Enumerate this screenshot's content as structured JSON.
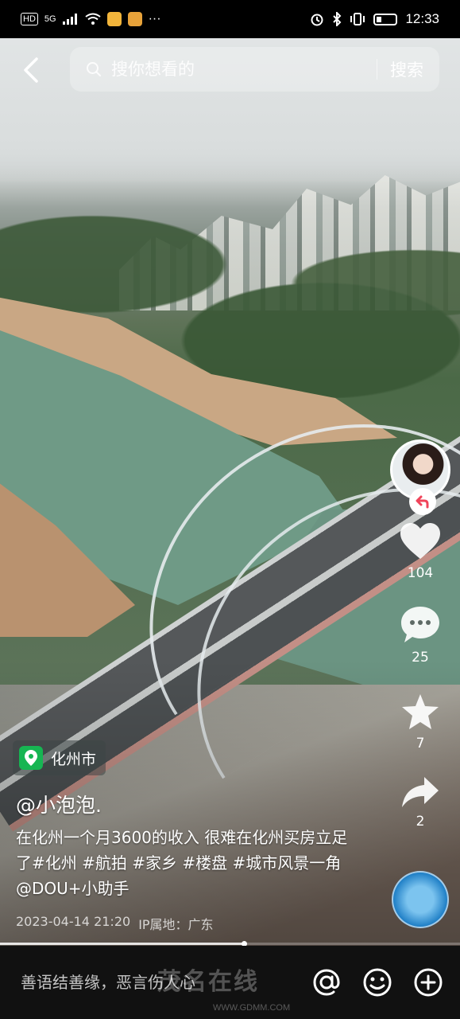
{
  "status_bar": {
    "network_label": "HD",
    "signal_label": "5G",
    "time": "12:33",
    "more": "···"
  },
  "search": {
    "placeholder": "搜你想看的",
    "button_label": "搜索"
  },
  "video": {
    "location": "化州市",
    "author": "@小泡泡.",
    "description": "在化州一个月3600的收入 很难在化州买房立足了#化州 #航拍 #家乡 #楼盘 #城市风景一角 @DOU+小助手",
    "datetime": "2023-04-14 21:20",
    "ip_location": "IP属地：广东",
    "progress": 0.53
  },
  "actions": {
    "likes": "104",
    "comments": "25",
    "favorites": "7",
    "shares": "2"
  },
  "comment_bar": {
    "placeholder": "善语结善缘，恶言伤人心"
  },
  "watermark": {
    "brand": "茂名在线",
    "url": "WWW.GDMM.COM"
  },
  "icons": [
    "back-icon",
    "search-icon",
    "heart-icon",
    "comment-icon",
    "star-icon",
    "share-icon",
    "location-icon",
    "at-icon",
    "emoji-icon",
    "plus-icon"
  ]
}
